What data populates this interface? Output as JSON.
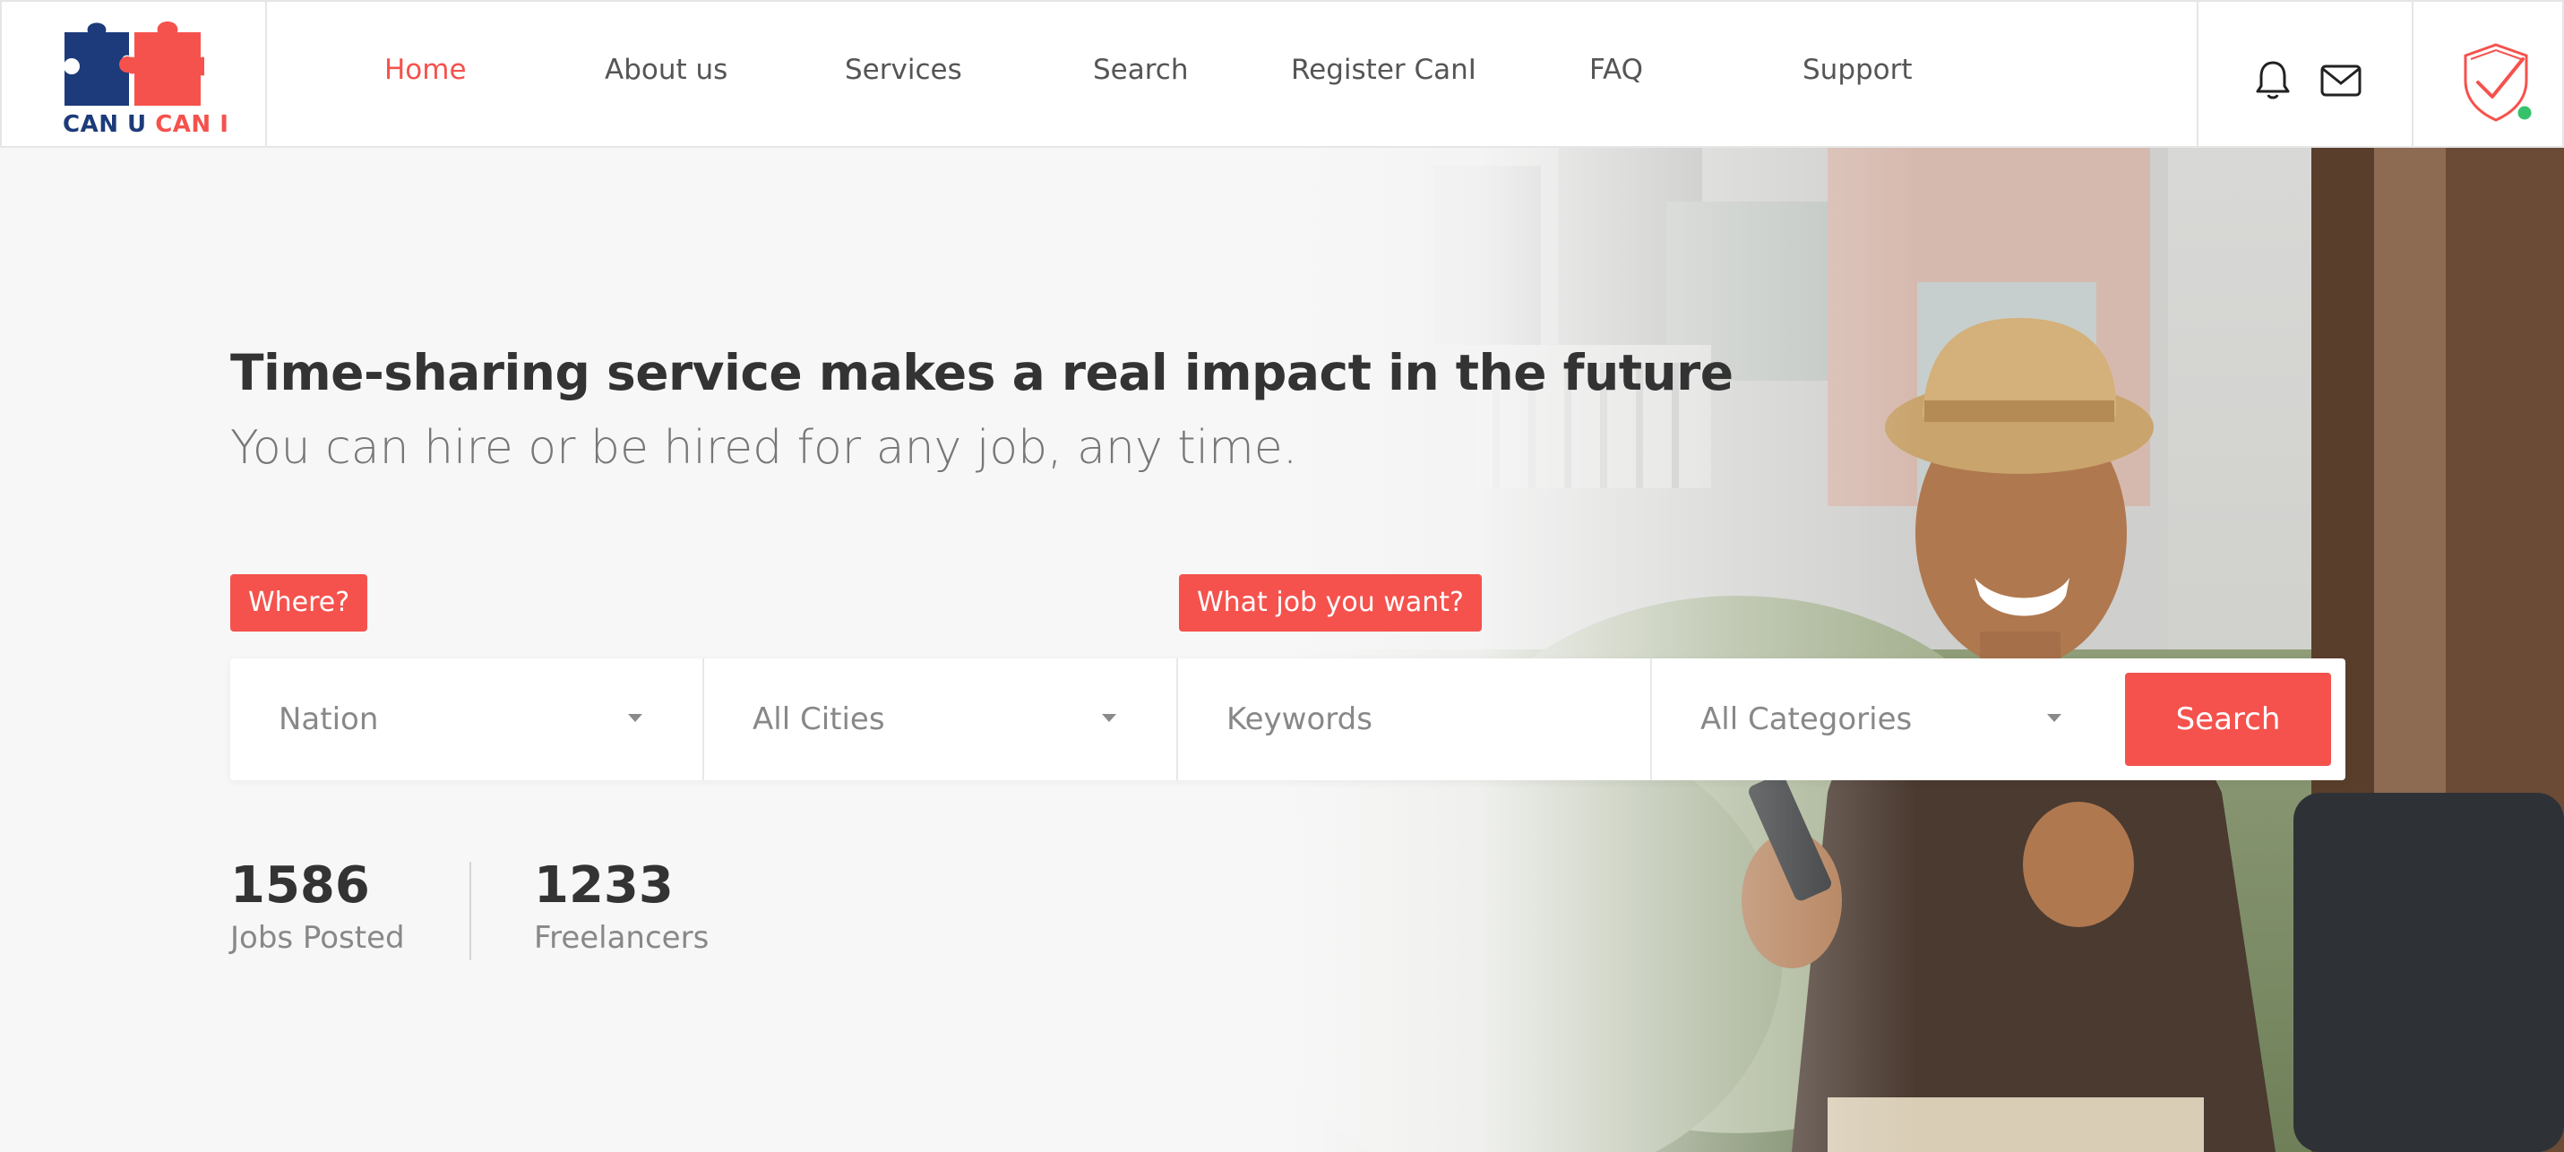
{
  "brand": {
    "logo_text_a": "CAN U",
    "logo_text_b": "CAN I",
    "colors": {
      "navy": "#1d3b7a",
      "coral": "#f5524d"
    }
  },
  "nav": {
    "items": [
      {
        "label": "Home",
        "active": true
      },
      {
        "label": "About us"
      },
      {
        "label": "Services"
      },
      {
        "label": "Search"
      },
      {
        "label": "Register CanI"
      },
      {
        "label": "FAQ"
      },
      {
        "label": "Support"
      }
    ],
    "icons": [
      "bell-icon",
      "mail-icon",
      "shield-check-icon"
    ]
  },
  "hero": {
    "headline": "Time-sharing service makes a real impact in the future",
    "subline": "You can hire or be hired for any job, any time.",
    "where_tag": "Where?",
    "job_tag": "What job you want?",
    "search": {
      "nation": "Nation",
      "cities": "All Cities",
      "keywords_placeholder": "Keywords",
      "categories": "All Categories",
      "button": "Search"
    },
    "stats": [
      {
        "value": "1586",
        "label": "Jobs Posted"
      },
      {
        "value": "1233",
        "label": "Freelancers"
      }
    ]
  },
  "accent_color": "#f5524d"
}
